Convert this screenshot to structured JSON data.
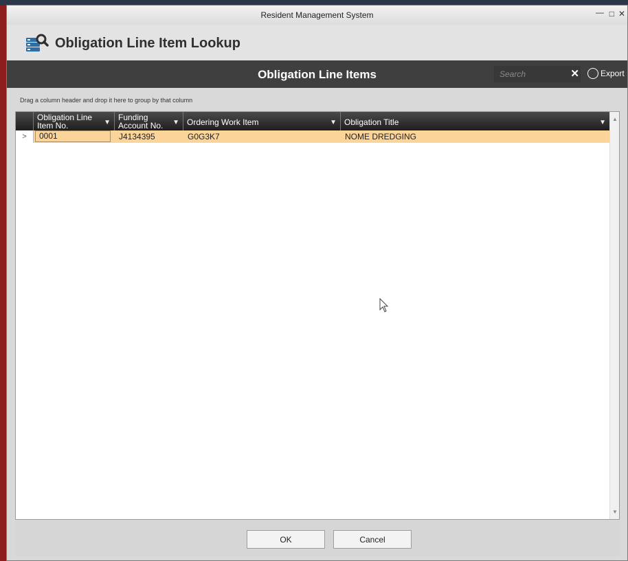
{
  "window": {
    "title": "Resident Management System",
    "min_glyph": "—",
    "max_glyph": "□",
    "close_glyph": "✕"
  },
  "header": {
    "title": "Obligation Line Item Lookup",
    "icon": "database-search-icon"
  },
  "toolbar": {
    "title": "Obligation Line Items",
    "search_placeholder": "Search",
    "clear_glyph": "✕",
    "export_label": "Export"
  },
  "grid": {
    "group_hint": "Drag a column header and drop it here to group by that column",
    "columns": [
      {
        "line1": "Obligation Line",
        "line2": "Item No."
      },
      {
        "line1": "Funding",
        "line2": "Account No."
      },
      {
        "line1": "Ordering Work Item",
        "line2": ""
      },
      {
        "line1": "Obligation Title",
        "line2": ""
      }
    ],
    "filter_glyph": "▼",
    "rows": [
      {
        "indicator": ">",
        "line_item_no": "0001",
        "funding_account_no": "J4134395",
        "ordering_work_item": "G0G3K7",
        "obligation_title": "NOME DREDGING"
      }
    ]
  },
  "footer": {
    "ok_label": "OK",
    "cancel_label": "Cancel"
  },
  "colors": {
    "selected_row": "#fbd49a",
    "toolbar_bg": "#3f3f3f",
    "header_icon": "#2b6ea8"
  }
}
